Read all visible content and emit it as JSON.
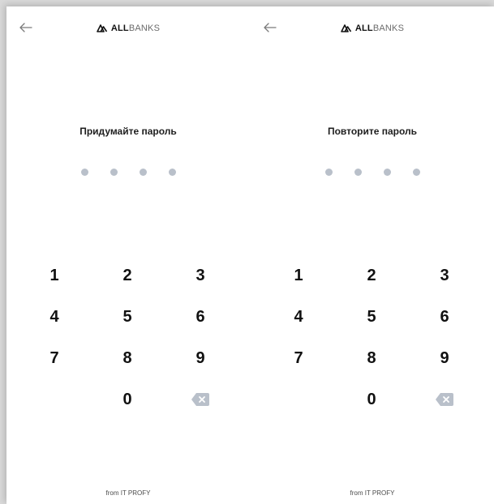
{
  "brand": {
    "part1": "ALL",
    "part2": "BANKS",
    "logo_icon": "allbanks-logo-icon"
  },
  "screens": [
    {
      "title": "Придумайте пароль",
      "pin_dots_filled": 0,
      "pin_length": 4,
      "footer": "from IT PROFY"
    },
    {
      "title": "Повторите пароль",
      "pin_dots_filled": 0,
      "pin_length": 4,
      "footer": "from IT PROFY"
    }
  ],
  "keypad": {
    "keys": [
      "1",
      "2",
      "3",
      "4",
      "5",
      "6",
      "7",
      "8",
      "9",
      "",
      "0",
      "backspace"
    ],
    "backspace_icon": "backspace-icon"
  },
  "colors": {
    "dot_empty": "#b9c0ca",
    "backspace": "#b9c0ca",
    "text": "#111111"
  },
  "icons": {
    "back": "arrow-left-icon"
  }
}
